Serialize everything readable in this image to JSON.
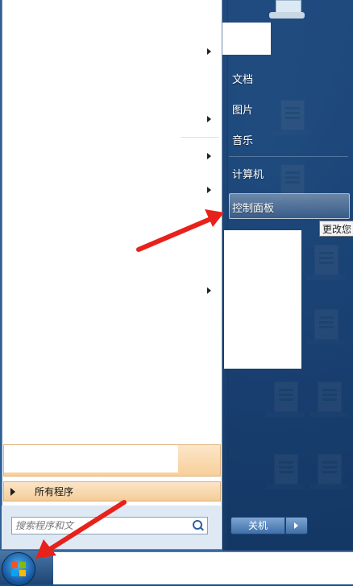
{
  "start_menu": {
    "right_items": [
      {
        "label": "文档"
      },
      {
        "label": "图片"
      },
      {
        "label": "音乐"
      },
      {
        "label": "计算机"
      },
      {
        "label": "控制面板"
      }
    ],
    "tooltip": "更改您",
    "all_programs": "所有程序",
    "search_placeholder": "搜索程序和文",
    "shutdown": "关机"
  },
  "annotations": {
    "arrow_color": "#e8211b"
  }
}
